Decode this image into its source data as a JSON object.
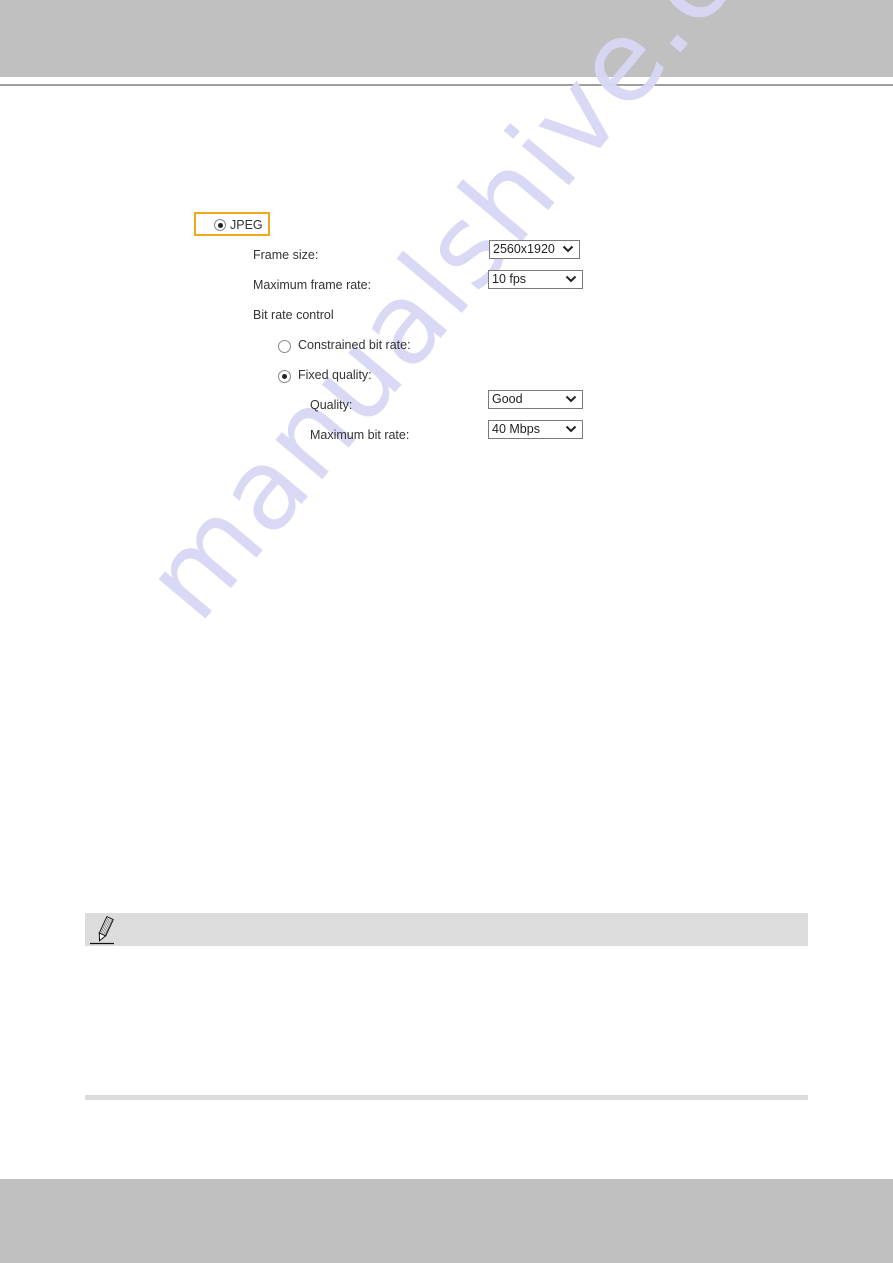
{
  "watermark": "manualshive.com",
  "codec": {
    "option_label": "JPEG",
    "selected": true,
    "highlight_color": "#f0a81c"
  },
  "settings": {
    "frame_size": {
      "label": "Frame size:",
      "value": "2560x1920"
    },
    "max_frame_rate": {
      "label": "Maximum frame rate:",
      "value": "10 fps"
    },
    "bit_rate_control": {
      "label": "Bit rate control",
      "options": [
        {
          "label": "Constrained bit rate:",
          "selected": false
        },
        {
          "label": "Fixed quality:",
          "selected": true
        }
      ],
      "quality": {
        "label": "Quality:",
        "value": "Good"
      },
      "max_bit_rate": {
        "label": "Maximum bit rate:",
        "value": "40 Mbps"
      }
    }
  },
  "note": {
    "icon": "pencil-icon"
  }
}
